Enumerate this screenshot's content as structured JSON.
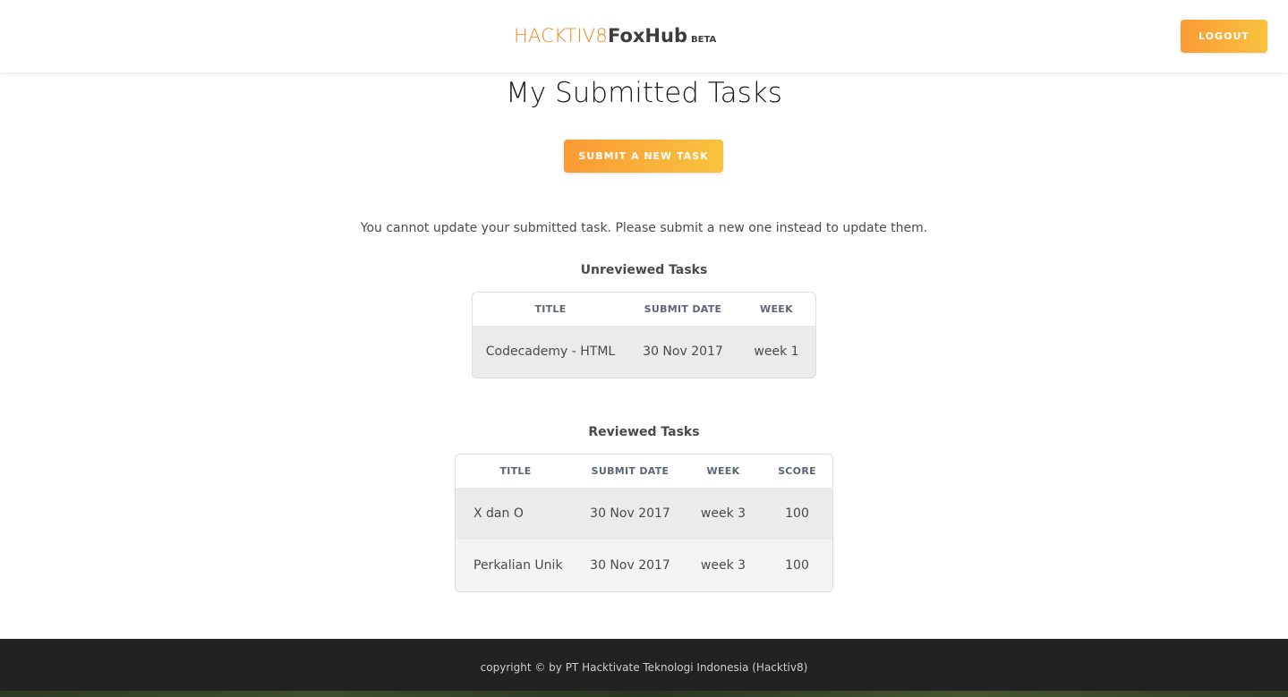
{
  "header": {
    "brand_light": "HACKTIV8",
    "brand_bold": "FoxHub",
    "brand_beta": "BETA",
    "logout_label": "LOGOUT"
  },
  "main": {
    "title": "My Submitted Tasks",
    "submit_label": "SUBMIT A NEW TASK",
    "notice": "You cannot update your submitted task. Please submit a new one instead to update them."
  },
  "unreviewed": {
    "heading": "Unreviewed Tasks",
    "columns": [
      "TITLE",
      "SUBMIT DATE",
      "WEEK"
    ],
    "rows": [
      {
        "title": "Codecademy - HTML",
        "submit_date": "30 Nov 2017",
        "week": "week 1"
      }
    ]
  },
  "reviewed": {
    "heading": "Reviewed Tasks",
    "columns": [
      "TITLE",
      "SUBMIT DATE",
      "WEEK",
      "SCORE"
    ],
    "rows": [
      {
        "title": "X dan O",
        "submit_date": "30 Nov 2017",
        "week": "week 3",
        "score": "100"
      },
      {
        "title": "Perkalian Unik",
        "submit_date": "30 Nov 2017",
        "week": "week 3",
        "score": "100"
      }
    ]
  },
  "footer": {
    "copyright": "copyright © by PT Hacktivate Teknologi Indonesia (Hacktiv8)"
  },
  "colors": {
    "accent_start": "#fa9a35",
    "accent_end": "#f8c33f",
    "brand_orange": "#f08a24",
    "footer_bg": "#222222"
  }
}
